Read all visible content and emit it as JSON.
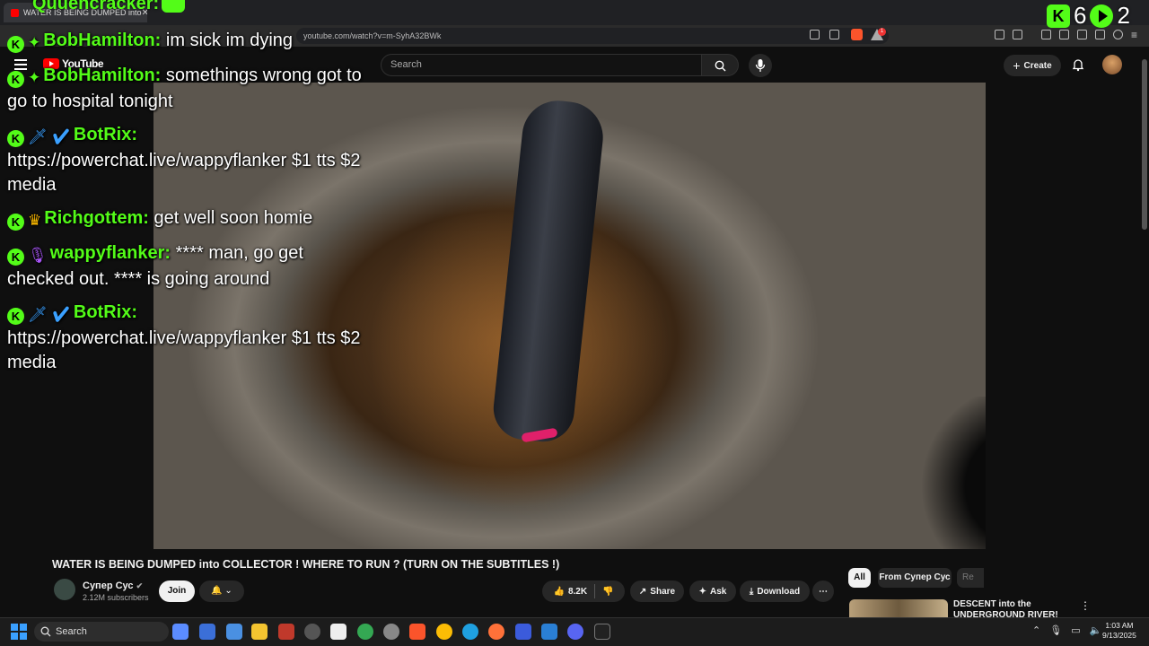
{
  "browser": {
    "tab_title": "WATER IS BEING DUMPED into",
    "url": "youtube.com/watch?v=m-SyhA32BWk",
    "ext_badge_count": "1"
  },
  "youtube": {
    "logo_text": "YouTube",
    "search_placeholder": "Search",
    "create_label": "Create"
  },
  "overlay": {
    "top_partial_name": "Quuencracker:",
    "counters": {
      "kick_count": "6",
      "play_count": "2"
    },
    "chat": [
      {
        "username": "BobHamilton:",
        "user_color": "#53fc18",
        "badge2": "✦",
        "badge2_color": "#53fc18",
        "text": "im sick im dying"
      },
      {
        "username": "BobHamilton:",
        "user_color": "#53fc18",
        "badge2": "✦",
        "badge2_color": "#53fc18",
        "text": "somethings wrong got to go to hospital tonight"
      },
      {
        "username": "BotRix:",
        "user_color": "#53fc18",
        "badge2": "🗡 ✔",
        "badge2_color": "#3aa0ff",
        "text": "https://powerchat.live/wappyflanker $1 tts $2 media"
      },
      {
        "username": "Richgottem:",
        "user_color": "#53fc18",
        "badge2": "♛",
        "badge2_color": "#f5b400",
        "text": "get well soon homie"
      },
      {
        "username": "wappyflanker:",
        "user_color": "#53fc18",
        "badge2": "🎙",
        "badge2_color": "#a855f7",
        "text": "**** man, go get checked out. **** is going around"
      },
      {
        "username": "BotRix:",
        "user_color": "#53fc18",
        "badge2": "🗡 ✔",
        "badge2_color": "#3aa0ff",
        "text": "https://powerchat.live/wappyflanker $1 tts $2 media"
      }
    ]
  },
  "video": {
    "title": "WATER IS BEING DUMPED into COLLECTOR ! WHERE TO RUN ? (TURN ON THE SUBTITLES !)",
    "channel_name": "Супер Сус",
    "subscribers": "2.12M subscribers",
    "join_label": "Join",
    "likes": "8.2K",
    "share_label": "Share",
    "ask_label": "Ask",
    "download_label": "Download"
  },
  "sidebar": {
    "chips": [
      "All",
      "From Супер Сус",
      "Re"
    ],
    "rec_title": "DESCENT into the UNDERGROUND RIVER! SURE"
  },
  "taskbar": {
    "search_label": "Search",
    "time": "1:03 AM",
    "date": "9/13/2025"
  }
}
